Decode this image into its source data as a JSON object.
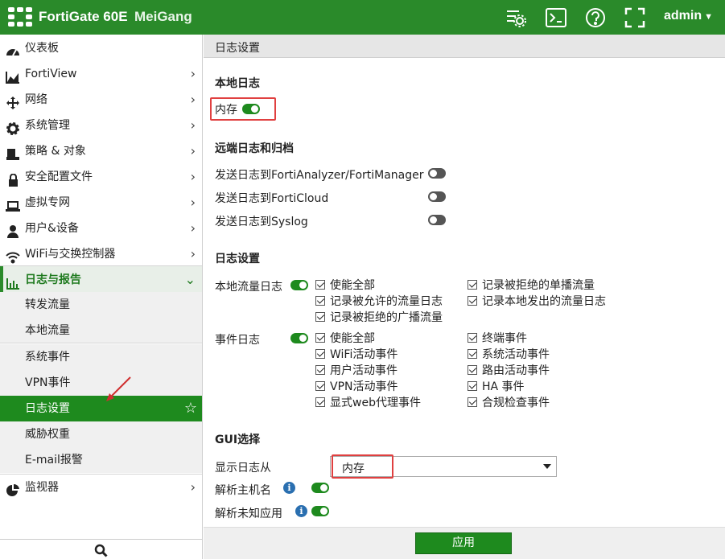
{
  "header": {
    "product": "FortiGate 60E",
    "hostname": "MeiGang",
    "user": "admin",
    "icons": [
      "settings-list-icon",
      "cli-console-icon",
      "help-icon",
      "fullscreen-icon"
    ]
  },
  "sidebar": {
    "items": [
      {
        "label": "仪表板",
        "icon": "dashboard-icon"
      },
      {
        "label": "FortiView",
        "icon": "chart-icon"
      },
      {
        "label": "网络",
        "icon": "move-arrows-icon"
      },
      {
        "label": "系统管理",
        "icon": "gear-icon"
      },
      {
        "label": "策略 & 对象",
        "icon": "policy-icon"
      },
      {
        "label": "安全配置文件",
        "icon": "lock-icon"
      },
      {
        "label": "虚拟专网",
        "icon": "laptop-icon"
      },
      {
        "label": "用户&设备",
        "icon": "user-icon"
      },
      {
        "label": "WiFi与交换控制器",
        "icon": "wifi-icon"
      },
      {
        "label": "日志与报告",
        "icon": "bar-chart-icon"
      },
      {
        "label": "监视器",
        "icon": "pie-chart-icon"
      }
    ],
    "subitems": [
      "转发流量",
      "本地流量",
      "系统事件",
      "VPN事件",
      "日志设置",
      "威胁权重",
      "E-mail报警"
    ]
  },
  "main": {
    "title": "日志设置",
    "local_log": {
      "heading": "本地日志",
      "memory_label": "内存"
    },
    "remote": {
      "heading": "远端日志和归档",
      "items": [
        "发送日志到FortiAnalyzer/FortiManager",
        "发送日志到FortiCloud",
        "发送日志到Syslog"
      ]
    },
    "log_settings": {
      "heading": "日志设置",
      "local_traffic_label": "本地流量日志",
      "local_traffic_checks_left": [
        "使能全部",
        "记录被允许的流量日志",
        "记录被拒绝的广播流量"
      ],
      "local_traffic_checks_right": [
        "记录被拒绝的单播流量",
        "记录本地发出的流量日志"
      ],
      "event_label": "事件日志",
      "event_checks_left": [
        "使能全部",
        "WiFi活动事件",
        "用户活动事件",
        "VPN活动事件",
        "显式web代理事件"
      ],
      "event_checks_right": [
        "终端事件",
        "系统活动事件",
        "路由活动事件",
        "HA 事件",
        "合规检查事件"
      ]
    },
    "gui": {
      "heading": "GUI选择",
      "display_from_label": "显示日志从",
      "display_from_value": "内存",
      "resolve_host_label": "解析主机名",
      "resolve_app_label": "解析未知应用"
    },
    "apply_label": "应用"
  },
  "colors": {
    "brand": "#2a8a2a",
    "highlight_box": "#e04040"
  }
}
